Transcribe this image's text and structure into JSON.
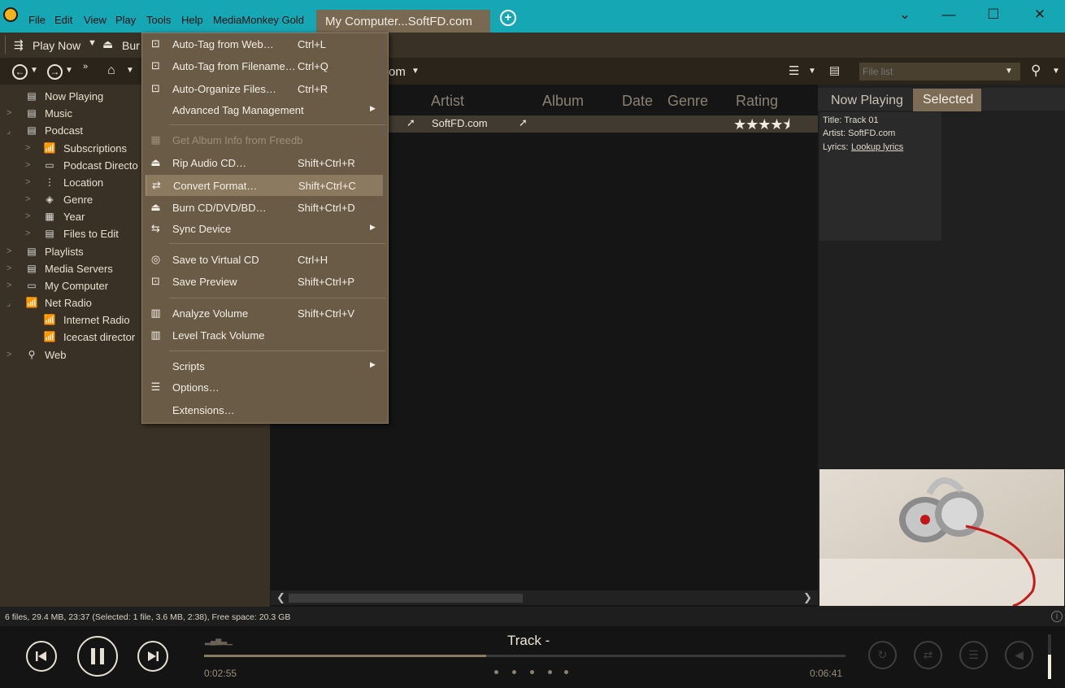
{
  "titlebar": {
    "menus": [
      "File",
      "Edit",
      "View",
      "Play",
      "Tools",
      "Help",
      "MediaMonkey Gold"
    ],
    "tab_title": "My Computer...SoftFD.com",
    "win_controls": {
      "chevron": "⌄",
      "min": "—",
      "max": "☐",
      "close": "✕"
    }
  },
  "toolbar": {
    "play_now": "Play Now",
    "burn": "Bur",
    "breadcrumb": "om",
    "file_list_placeholder": "File list"
  },
  "tree": [
    {
      "label": "Now Playing",
      "icon": "now-playing-icon",
      "glyph": "▤"
    },
    {
      "label": "Music",
      "icon": "music-icon",
      "glyph": "▤"
    },
    {
      "label": "Podcast",
      "icon": "podcast-icon",
      "glyph": "▤"
    },
    {
      "label": "Subscriptions",
      "icon": "subscriptions-icon",
      "glyph": "📶"
    },
    {
      "label": "Podcast Directo",
      "icon": "folder-icon",
      "glyph": "▭"
    },
    {
      "label": "Location",
      "icon": "location-icon",
      "glyph": "⋮"
    },
    {
      "label": "Genre",
      "icon": "genre-icon",
      "glyph": "◈"
    },
    {
      "label": "Year",
      "icon": "year-icon",
      "glyph": "▦"
    },
    {
      "label": "Files to Edit",
      "icon": "files-to-edit-icon",
      "glyph": "▤"
    },
    {
      "label": "Playlists",
      "icon": "playlists-icon",
      "glyph": "▤"
    },
    {
      "label": "Media Servers",
      "icon": "media-servers-icon",
      "glyph": "▤"
    },
    {
      "label": "My Computer",
      "icon": "computer-icon",
      "glyph": "▭"
    },
    {
      "label": "Net Radio",
      "icon": "radio-icon",
      "glyph": "📶"
    },
    {
      "label": "Internet Radio",
      "icon": "radio-icon",
      "glyph": "📶"
    },
    {
      "label": "Icecast director",
      "icon": "radio-icon",
      "glyph": "📶"
    },
    {
      "label": "Web",
      "icon": "web-icon",
      "glyph": "⚲"
    }
  ],
  "menu": {
    "items": [
      {
        "label": "Auto-Tag from Web…",
        "shortcut": "Ctrl+L",
        "icon": "tag-web-icon",
        "glyph": "⊡"
      },
      {
        "label": "Auto-Tag from Filename…",
        "shortcut": "Ctrl+Q",
        "icon": "tag-file-icon",
        "glyph": "⊡"
      },
      {
        "label": "Auto-Organize Files…",
        "shortcut": "Ctrl+R",
        "icon": "organize-icon",
        "glyph": "⊡"
      },
      {
        "label": "Advanced Tag Management",
        "shortcut": "",
        "icon": "",
        "glyph": "",
        "submenu": true
      },
      {
        "label": "Get Album Info from Freedb",
        "shortcut": "",
        "icon": "freedb-icon",
        "glyph": "▦",
        "disabled": true
      },
      {
        "label": "Rip Audio CD…",
        "shortcut": "Shift+Ctrl+R",
        "icon": "rip-icon",
        "glyph": "⏏"
      },
      {
        "label": "Convert Format…",
        "shortcut": "Shift+Ctrl+C",
        "icon": "convert-icon",
        "glyph": "⇄",
        "highlight": true
      },
      {
        "label": "Burn CD/DVD/BD…",
        "shortcut": "Shift+Ctrl+D",
        "icon": "burn-icon",
        "glyph": "⏏"
      },
      {
        "label": "Sync Device",
        "shortcut": "",
        "icon": "sync-icon",
        "glyph": "⇆",
        "submenu": true
      },
      {
        "label": "Save to Virtual CD",
        "shortcut": "Ctrl+H",
        "icon": "virtual-cd-icon",
        "glyph": "◎"
      },
      {
        "label": "Save Preview",
        "shortcut": "Shift+Ctrl+P",
        "icon": "preview-icon",
        "glyph": "⊡"
      },
      {
        "label": "Analyze Volume",
        "shortcut": "Shift+Ctrl+V",
        "icon": "analyze-icon",
        "glyph": "▥"
      },
      {
        "label": "Level Track Volume",
        "shortcut": "",
        "icon": "level-icon",
        "glyph": "▥"
      },
      {
        "label": "Scripts",
        "shortcut": "",
        "icon": "",
        "glyph": "",
        "submenu": true
      },
      {
        "label": "Options…",
        "shortcut": "",
        "icon": "options-icon",
        "glyph": "☰"
      },
      {
        "label": "Extensions…",
        "shortcut": "",
        "icon": "",
        "glyph": ""
      }
    ]
  },
  "list": {
    "columns": [
      "Artist",
      "Album",
      "Date",
      "Genre",
      "Rating"
    ],
    "row": {
      "artist": "SoftFD.com",
      "rating": "★★★★⯨"
    }
  },
  "info": {
    "tabs": [
      "Now Playing",
      "Selected"
    ],
    "title_line": "Title: Track 01",
    "artist_line": "Artist: SoftFD.com",
    "lyrics_label": "Lyrics:",
    "lyrics_link": "Lookup lyrics"
  },
  "status": "6 files, 29.4 MB, 23:37 (Selected: 1 file, 3.6 MB, 2:38), Free space: 20.3 GB",
  "player": {
    "track": "Track -",
    "elapsed": "0:02:55",
    "total": "0:06:41",
    "progress": 0.44,
    "volume": 0.55
  },
  "watermark": "SoftFD.com"
}
